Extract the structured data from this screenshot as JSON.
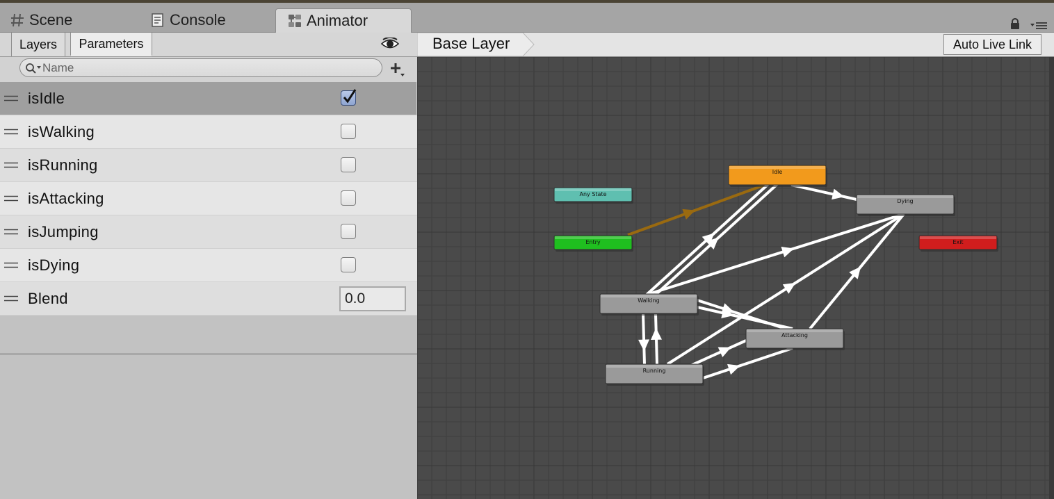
{
  "window_tabs": {
    "scene": "Scene",
    "console": "Console",
    "animator": "Animator"
  },
  "icons": {
    "scene": "hash-icon",
    "console": "console-icon",
    "animator": "animator-icon",
    "lock": "lock-icon",
    "menu": "menu-icon",
    "eye": "eye-icon",
    "search": "search-icon",
    "add": "plus-dropdown-icon",
    "drag": "drag-handle-icon"
  },
  "panel_tabs": {
    "layers": "Layers",
    "parameters": "Parameters"
  },
  "search": {
    "placeholder": "Name"
  },
  "parameters": [
    {
      "name": "isIdle",
      "type": "bool",
      "value": true
    },
    {
      "name": "isWalking",
      "type": "bool",
      "value": false
    },
    {
      "name": "isRunning",
      "type": "bool",
      "value": false
    },
    {
      "name": "isAttacking",
      "type": "bool",
      "value": false
    },
    {
      "name": "isJumping",
      "type": "bool",
      "value": false
    },
    {
      "name": "isDying",
      "type": "bool",
      "value": false
    },
    {
      "name": "Blend",
      "type": "float",
      "value": "0.0"
    }
  ],
  "breadcrumb": {
    "layer": "Base Layer"
  },
  "toolbar": {
    "auto_live_link": "Auto Live Link"
  },
  "states": {
    "idle": {
      "label": "Idle",
      "color": "#f29a1c"
    },
    "any_state": {
      "label": "Any State",
      "color": "#5fbfb0"
    },
    "entry": {
      "label": "Entry",
      "color": "#1fbf1f"
    },
    "dying": {
      "label": "Dying",
      "color": "#9a9a9a"
    },
    "exit": {
      "label": "Exit",
      "color": "#d11d1d"
    },
    "walking": {
      "label": "Walking",
      "color": "#9a9a9a"
    },
    "attacking": {
      "label": "Attacking",
      "color": "#9a9a9a"
    },
    "running": {
      "label": "Running",
      "color": "#9a9a9a"
    }
  },
  "colors": {
    "graph_background": "#4a4a4a",
    "transition": "#ffffff",
    "default_transition": "#9a6a10",
    "selected_row": "#9f9f9f",
    "panel": "#c2c2c2"
  }
}
